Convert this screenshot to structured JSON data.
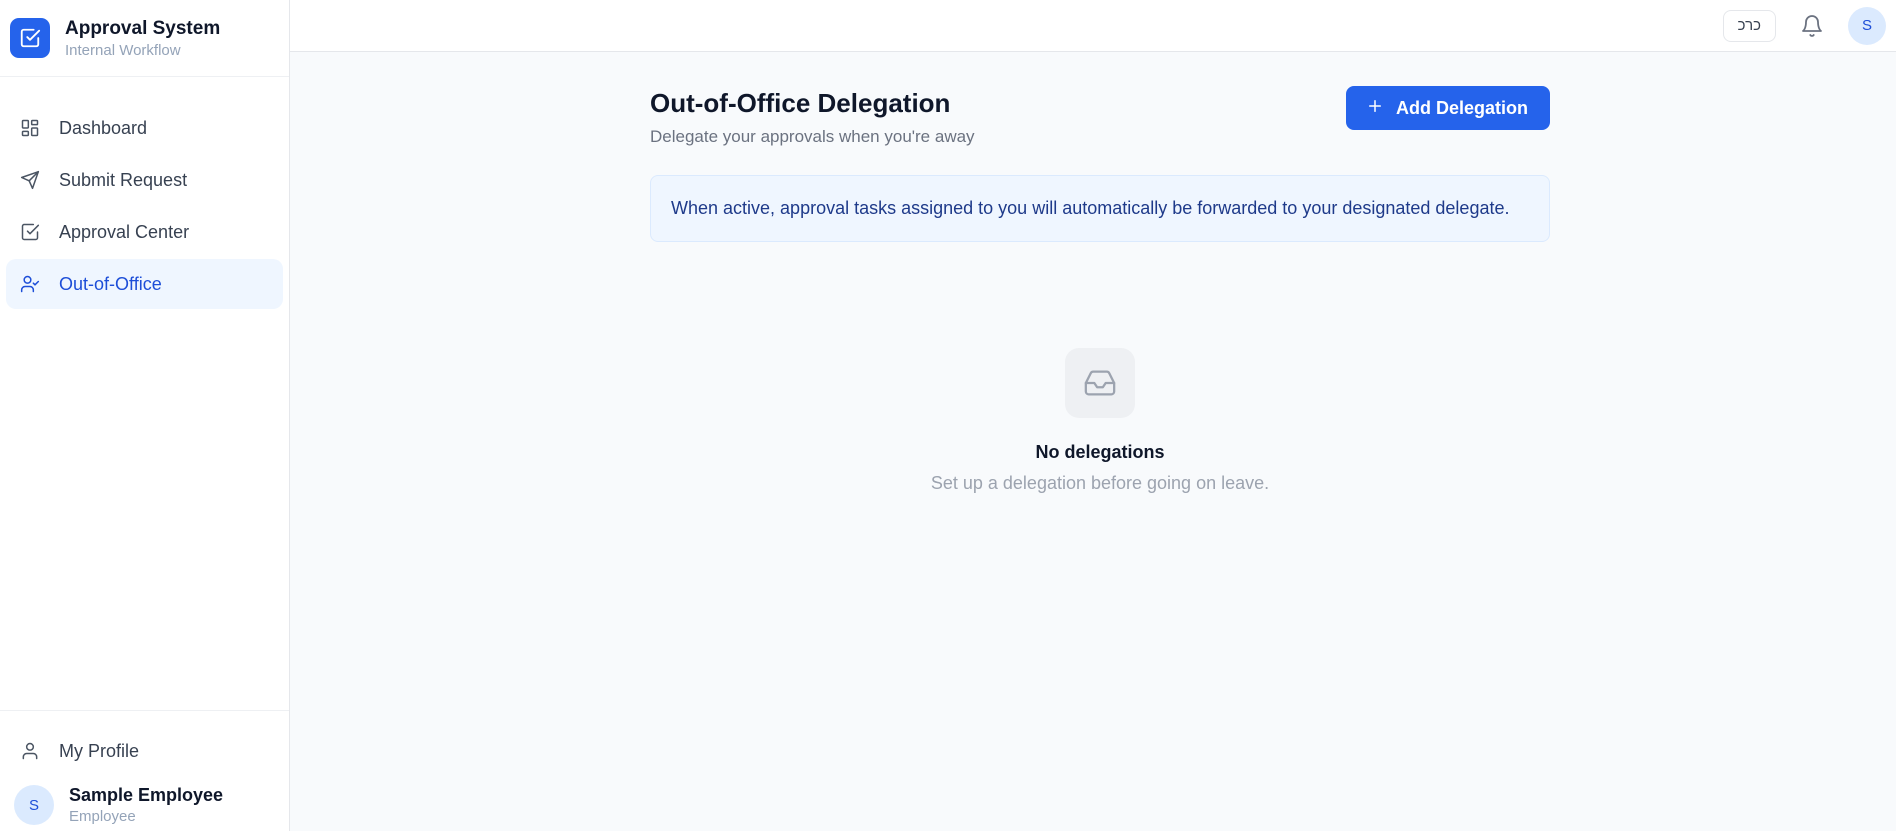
{
  "brand": {
    "title": "Approval System",
    "subtitle": "Internal Workflow"
  },
  "sidebar": {
    "items": [
      {
        "label": "Dashboard",
        "icon": "grid-icon",
        "active": false
      },
      {
        "label": "Submit Request",
        "icon": "send-icon",
        "active": false
      },
      {
        "label": "Approval Center",
        "icon": "check-square-icon",
        "active": false
      },
      {
        "label": "Out-of-Office",
        "icon": "user-check-icon",
        "active": true
      }
    ],
    "profile_link": "My Profile",
    "user": {
      "initial": "S",
      "name": "Sample Employee",
      "role": "Employee"
    }
  },
  "topbar": {
    "language_label": "כרכ",
    "avatar_initial": "S"
  },
  "page": {
    "title": "Out-of-Office Delegation",
    "subtitle": "Delegate your approvals when you're away",
    "add_button": "Add Delegation",
    "info": "When active, approval tasks assigned to you will automatically be forwarded to your designated delegate.",
    "empty_title": "No delegations",
    "empty_subtitle": "Set up a delegation before going on leave."
  },
  "colors": {
    "accent": "#2563eb",
    "active_bg": "#eff6ff",
    "info_bg": "#eff6ff",
    "info_text": "#1e3a8a"
  }
}
